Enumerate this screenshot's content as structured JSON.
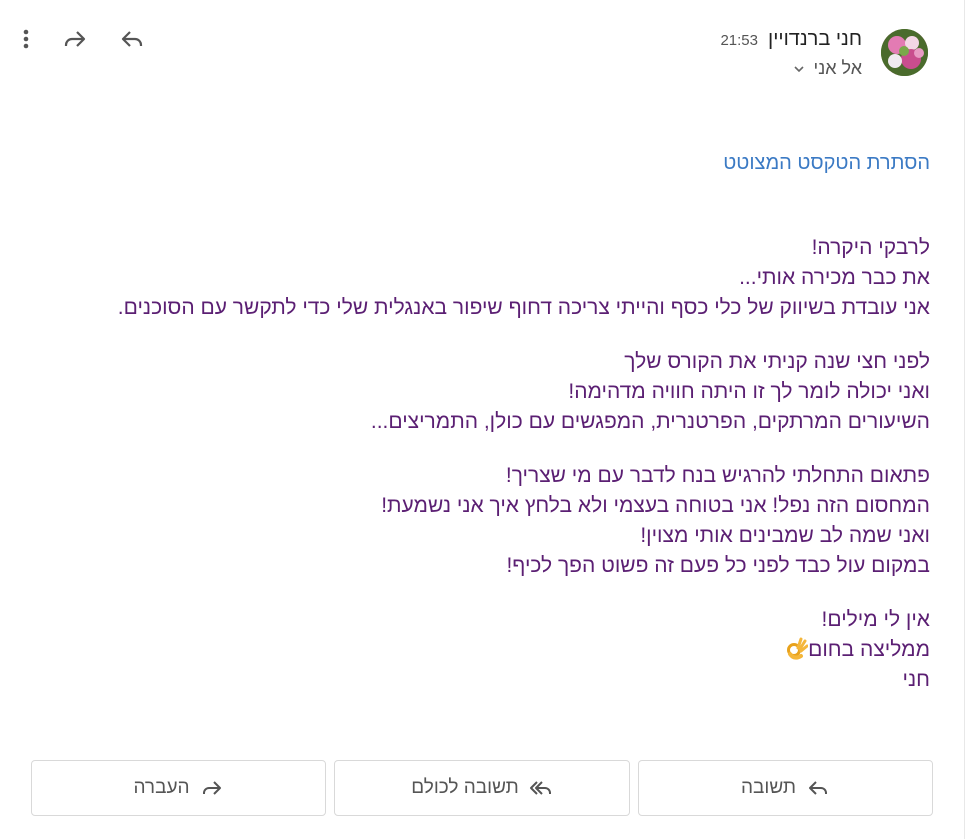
{
  "header": {
    "sender_name": "חני ברנדויין",
    "time": "21:53",
    "to_label": "אל אני",
    "icons": {
      "reply": "reply-icon",
      "forward": "forward-icon",
      "more": "more-vert-icon",
      "to_dropdown": "chevron-down-icon"
    }
  },
  "hide_quoted_label": "הסתרת הטקסט המצוטט",
  "message": {
    "paragraphs": [
      [
        "לרבקי היקרה!",
        "את כבר מכירה אותי...",
        "אני עובדת בשיווק של כלי כסף והייתי צריכה דחוף שיפור באנגלית שלי כדי לתקשר עם הסוכנים."
      ],
      [
        "לפני חצי שנה קניתי את הקורס שלך",
        "ואני יכולה לומר לך זו היתה חוויה מדהימה!",
        "השיעורים המרתקים, הפרטנרית, המפגשים עם כולן, התמריצים..."
      ],
      [
        "פתאום התחלתי להרגיש בנח לדבר עם מי שצריך!",
        "המחסום הזה נפל! אני בטוחה בעצמי ולא בלחץ איך אני נשמעת!",
        "ואני שמה לב שמבינים אותי מצוין!",
        "במקום עול כבד לפני כל פעם זה פשוט הפך לכיף!"
      ],
      [
        "אין לי מילים!",
        "ממליצה בחום",
        "חני"
      ]
    ],
    "text_color": "#5b1f73"
  },
  "actions": {
    "reply_label": "תשובה",
    "reply_all_label": "תשובה לכולם",
    "forward_label": "העברה"
  },
  "colors": {
    "link": "#3b7ac4",
    "message_text": "#5b1f73",
    "button_border": "#d9d9d9"
  }
}
